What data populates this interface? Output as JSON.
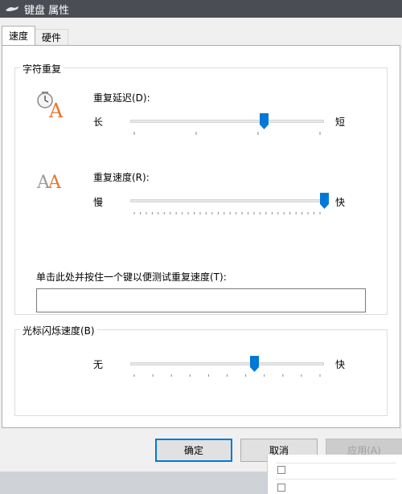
{
  "window": {
    "title": "键盘 属性",
    "icon": "keyboard-icon"
  },
  "tabs": [
    {
      "label": "速度",
      "active": true
    },
    {
      "label": "硬件",
      "active": false
    }
  ],
  "repeat_group": {
    "title": "字符重复",
    "delay": {
      "label": "重复延迟(D):",
      "min_label": "长",
      "max_label": "短",
      "value": 0.69,
      "icon": "clock-letter-icon"
    },
    "rate": {
      "label": "重复速度(R):",
      "min_label": "慢",
      "max_label": "快",
      "value": 1.0,
      "icon": "double-letter-icon"
    },
    "test": {
      "label": "单击此处并按住一个键以便测试重复速度(T):",
      "value": ""
    }
  },
  "cursor_group": {
    "title": "光标闪烁速度(B)",
    "min_label": "无",
    "max_label": "快",
    "value": 0.64
  },
  "buttons": {
    "ok": "确定",
    "cancel": "取消",
    "apply": "应用(A)"
  },
  "colors": {
    "accent": "#0078d7",
    "titlebar": "#4a4e54",
    "letter": "#e8742a"
  }
}
